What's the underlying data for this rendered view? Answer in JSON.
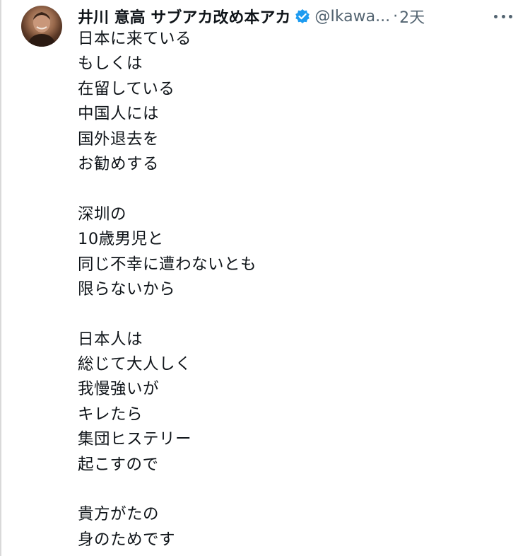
{
  "tweet": {
    "author_name": "井川 意高 サブアカ改め本アカ",
    "handle": "@Ikawa...",
    "separator": "·",
    "time": "2天",
    "stanzas": [
      [
        "日本に来ている",
        "もしくは",
        "在留している",
        "中国人には",
        "国外退去を",
        "お勧めする"
      ],
      [
        "深圳の",
        "10歳男児と",
        "同じ不幸に遭わないとも",
        "限らないから"
      ],
      [
        "日本人は",
        "総じて大人しく",
        "我慢強いが",
        "キレたら",
        "集団ヒステリー",
        "起こすので"
      ],
      [
        "貴方がたの",
        "身のためです"
      ]
    ]
  },
  "colors": {
    "text": "#0f1419",
    "muted": "#536471",
    "verified": "#1d9bf0"
  },
  "icons": {
    "verified": "verified-badge-icon",
    "more": "more-horizontal-icon"
  }
}
